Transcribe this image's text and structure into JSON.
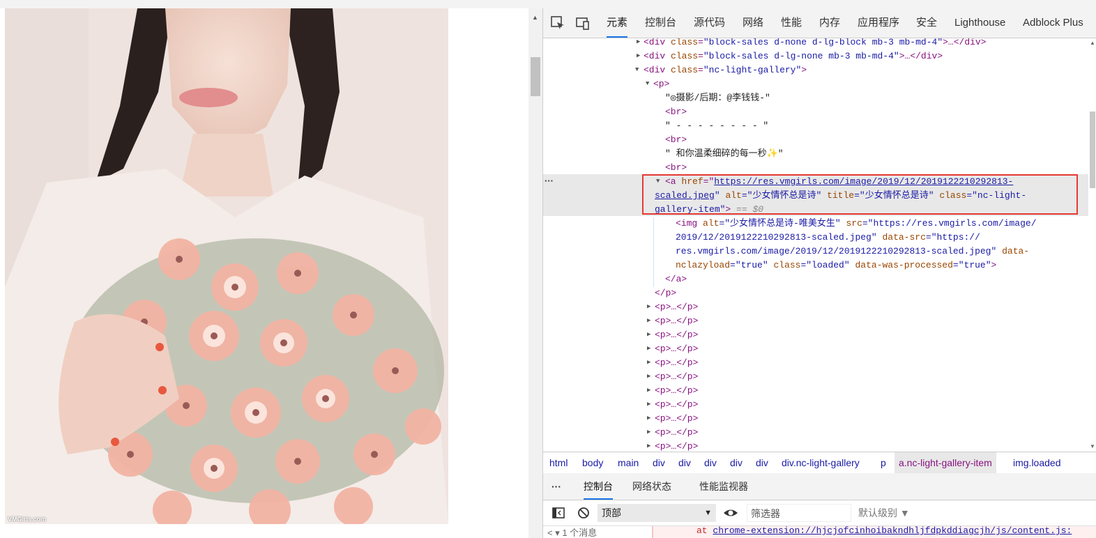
{
  "page": {
    "watermark": "VMGirls.com"
  },
  "devtools": {
    "tabs": [
      "元素",
      "控制台",
      "源代码",
      "网络",
      "性能",
      "内存",
      "应用程序",
      "安全",
      "Lighthouse",
      "Adblock Plus"
    ],
    "active_tab": "元素",
    "tree": {
      "l1": {
        "open": "<div",
        "attr": "class",
        "val": "\"block-sales d-none d-lg-block mb-3 mb-md-4\"",
        "close": ">…</div>"
      },
      "l2": {
        "open": "<div",
        "attr": "class",
        "val": "\"block-sales d-lg-none mb-3 mb-md-4\"",
        "close": ">…</div>"
      },
      "l3": {
        "open": "<div",
        "attr": "class",
        "val": "\"nc-light-gallery\"",
        "close": ">"
      },
      "l4": {
        "open": "<p>"
      },
      "l5": {
        "text": "\"◎摄影/后期：@李钱钱-\""
      },
      "l6": {
        "tag": "<br>"
      },
      "l7": {
        "text": "\" - - - - - - - - \""
      },
      "l8": {
        "tag": "<br>"
      },
      "l9": {
        "text": "\" 和你温柔细碎的每一秒✨\""
      },
      "l10": {
        "tag": "<br>"
      },
      "a_line1": {
        "open": "<a",
        "href_attr": "href",
        "href_q": "=\"",
        "href1": "https://res.vmgirls.com/image/2019/12/2019122210292813-"
      },
      "a_line2": {
        "href2": "scaled.jpeg",
        "q": "\"",
        "alt_attr": "alt",
        "alt_val": "=\"少女情怀总是诗\"",
        "title_attr": "title",
        "title_val": "=\"少女情怀总是诗\"",
        "class_attr": "class",
        "class_val1": "=\"nc-light-"
      },
      "a_line3": {
        "class_val2": "gallery-item\"",
        "close": ">",
        "eq": "== $0"
      },
      "img1": {
        "open": "<img",
        "alt_attr": "alt",
        "alt_val": "=\"少女情怀总是诗-唯美女生\"",
        "src_attr": "src",
        "src_val1": "=\"https://res.vmgirls.com/image/"
      },
      "img2": {
        "src_val2": "2019/12/2019122210292813-scaled.jpeg\"",
        "ds_attr": "data-src",
        "ds_val1": "=\"https://"
      },
      "img3": {
        "ds_val2": "res.vmgirls.com/image/2019/12/2019122210292813-scaled.jpeg\"",
        "dl_attr": "data-"
      },
      "img4": {
        "dl_attr2": "nclazyload",
        "dl_val": "=\"true\"",
        "cl_attr": "class",
        "cl_val": "=\"loaded\"",
        "wp_attr": "data-was-processed",
        "wp_val": "=\"true\"",
        "close": ">"
      },
      "a_close": "</a>",
      "p_close": "</p>",
      "collapsed_p": "<p>…</p>",
      "more_dots": "···"
    },
    "breadcrumbs": [
      "html",
      "body",
      "main",
      "div",
      "div",
      "div",
      "div",
      "div",
      "div.nc-light-gallery",
      "p",
      "a.nc-light-gallery-item",
      "img.loaded"
    ],
    "selected_crumb": "a.nc-light-gallery-item",
    "drawer": {
      "more": "···",
      "tabs": [
        "控制台",
        "网络状态",
        "性能监视器"
      ],
      "active": "控制台"
    },
    "console_toolbar": {
      "context": "顶部",
      "filter_placeholder": "筛选器",
      "level": "默认级别 ▼"
    },
    "console_line": {
      "side": "< ▾ 1 个消息",
      "at": "at",
      "url": "chrome-extension://hjcjofcinhoibakndhljfdpkddiagcjh/js/content.js:"
    }
  }
}
